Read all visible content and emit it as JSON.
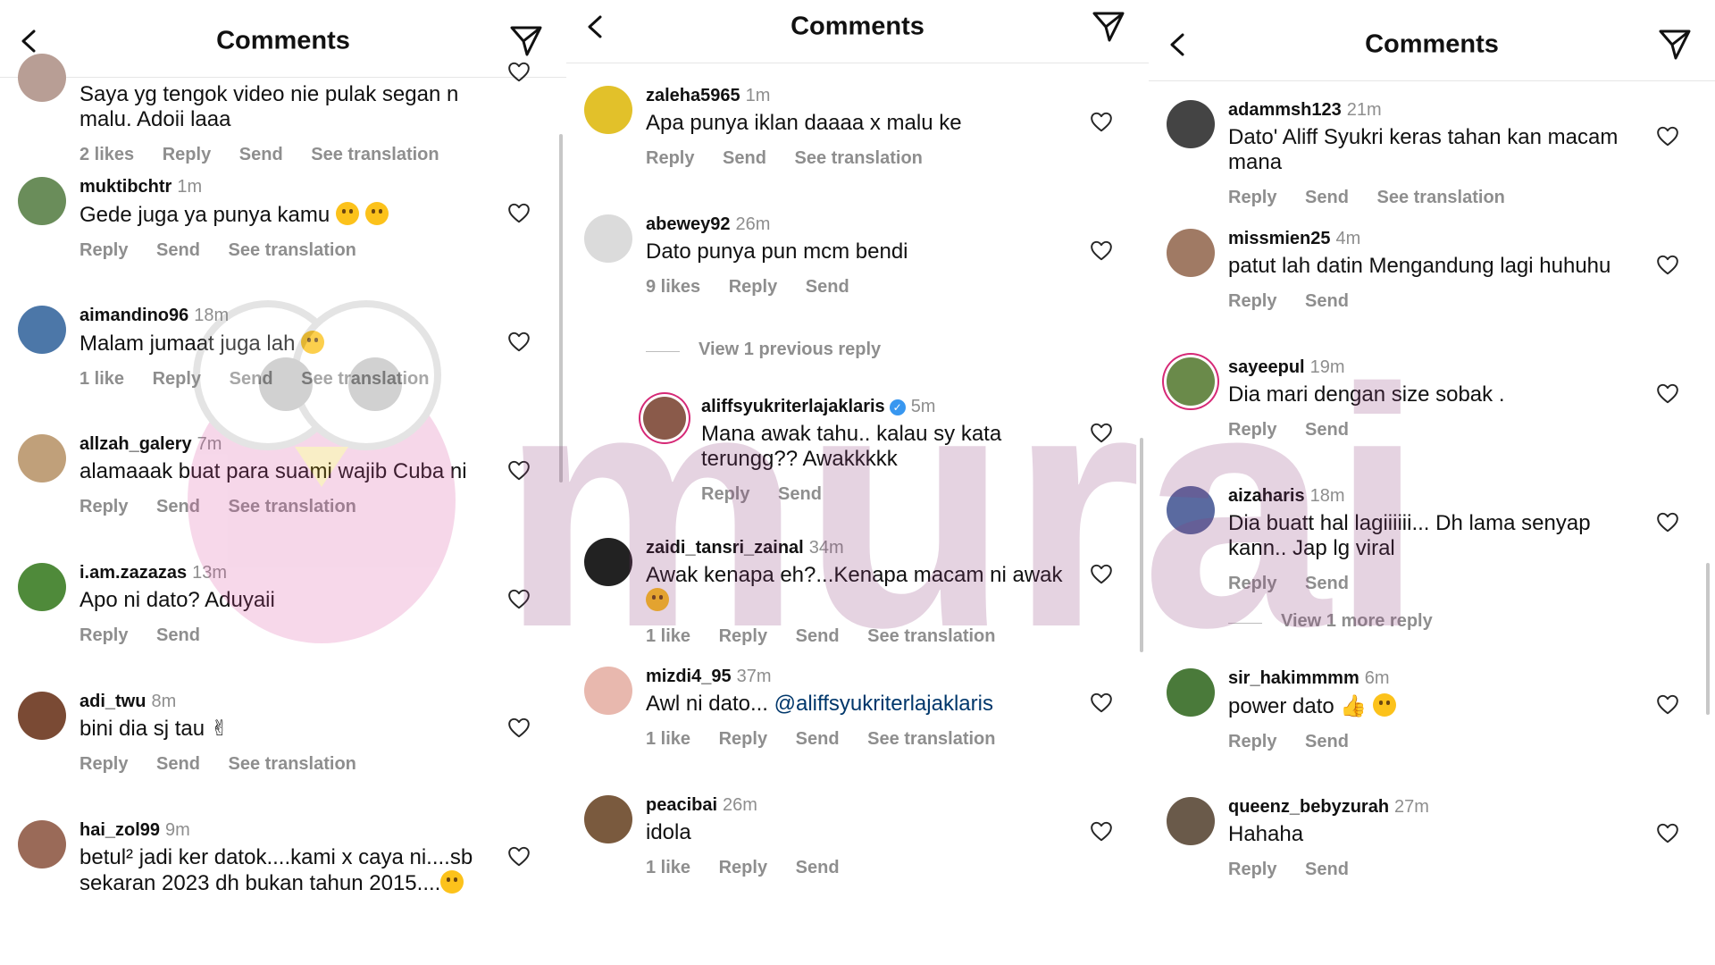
{
  "colors": {
    "text": "#111111",
    "meta": "#8e8e8e",
    "mention": "#00376b",
    "verified": "#3897f0",
    "accent": "#d62976"
  },
  "panels": [
    {
      "title": "Comments",
      "comments": [
        {
          "user": "",
          "time": "",
          "text": "Saya yg tengok video nie pulak segan n malu. Adoii laaa",
          "actions": [
            "2 likes",
            "Reply",
            "Send",
            "See translation"
          ],
          "avatar_color": "#b89e95"
        },
        {
          "user": "muktibchtr",
          "time": "1m",
          "text": "Gede juga ya punya kamu",
          "emoji": 2,
          "actions": [
            "Reply",
            "Send",
            "See translation"
          ],
          "avatar_color": "#6a8d5a"
        },
        {
          "user": "aimandino96",
          "time": "18m",
          "text": "Malam jumaat juga lah",
          "emoji": 1,
          "actions": [
            "1 like",
            "Reply",
            "Send",
            "See translation"
          ],
          "avatar_color": "#4c77a8"
        },
        {
          "user": "allzah_galery",
          "time": "7m",
          "text": "alamaaak  buat para suami wajib Cuba ni",
          "actions": [
            "Reply",
            "Send",
            "See translation"
          ],
          "avatar_color": "#c0a07a"
        },
        {
          "user": "i.am.zazazas",
          "time": "13m",
          "text": "Apo ni dato? Aduyaii",
          "actions": [
            "Reply",
            "Send"
          ],
          "avatar_color": "#4f8a3a"
        },
        {
          "user": "adi_twu",
          "time": "8m",
          "text": "bini dia sj tau",
          "actions": [
            "Reply",
            "Send",
            "See translation"
          ],
          "avatar_color": "#7a4a34"
        },
        {
          "user": "hai_zol99",
          "time": "9m",
          "text": "betul² jadi ker datok....kami x caya ni....sb sekaran 2023 dh bukan tahun 2015....",
          "actions": [],
          "avatar_color": "#9a6a58"
        }
      ]
    },
    {
      "title": "Comments",
      "comments": [
        {
          "user": "zaleha5965",
          "time": "1m",
          "text": "Apa punya iklan daaaa x malu ke",
          "actions": [
            "Reply",
            "Send",
            "See translation"
          ],
          "avatar_color": "#e2c12a"
        },
        {
          "user": "abewey92",
          "time": "26m",
          "text": "Dato punya pun mcm bendi",
          "actions": [
            "9 likes",
            "Reply",
            "Send"
          ],
          "avatar_color": "#dbdbdb"
        }
      ],
      "view_replies": "View 1 previous reply",
      "reply": {
        "user": "aliffsyukriterlajaklaris",
        "time": "5m",
        "text": "Mana awak tahu.. kalau sy kata terungg?? Awakkkkk",
        "actions": [
          "Reply",
          "Send"
        ],
        "avatar_color": "#8a5a4a"
      },
      "comments_after": [
        {
          "user": "zaidi_tansri_zainal",
          "time": "34m",
          "text": "Awak kenapa eh?...Kenapa macam ni awak",
          "actions": [
            "1 like",
            "Reply",
            "Send",
            "See translation"
          ],
          "avatar_color": "#222222"
        },
        {
          "user": "mizdi4_95",
          "time": "37m",
          "text": "Awl ni dato... ",
          "mention": "@aliffsyukriterlajaklaris",
          "actions": [
            "1 like",
            "Reply",
            "Send",
            "See translation"
          ],
          "avatar_color": "#e8b8ae"
        },
        {
          "user": "peacibai",
          "time": "26m",
          "text": "idola",
          "actions": [
            "1 like",
            "Reply",
            "Send"
          ],
          "avatar_color": "#7a5a3e"
        }
      ]
    },
    {
      "title": "Comments",
      "comments": [
        {
          "user": "adammsh123",
          "time": "21m",
          "text": "Dato' Aliff Syukri keras tahan kan macam mana",
          "actions": [
            "Reply",
            "Send",
            "See translation"
          ],
          "avatar_color": "#444444"
        },
        {
          "user": "missmien25",
          "time": "4m",
          "text": "patut lah datin Mengandung lagi huhuhu",
          "actions": [
            "Reply",
            "Send"
          ],
          "avatar_color": "#a07a64"
        },
        {
          "user": "sayeepul",
          "time": "19m",
          "text": "Dia mari dengan size sobak .",
          "actions": [
            "Reply",
            "Send"
          ],
          "avatar_color": "#6a8a4a",
          "ring": true
        },
        {
          "user": "aizaharis",
          "time": "18m",
          "text": "Dia buatt hal lagiiiiii... Dh lama senyap kann.. Jap lg viral",
          "actions": [
            "Reply",
            "Send"
          ],
          "avatar_color": "#5a6aa0"
        }
      ],
      "view_replies": "View 1 more reply",
      "comments_after": [
        {
          "user": "sir_hakimmmm",
          "time": "6m",
          "text": "power dato",
          "emoji": 1,
          "actions": [
            "Reply",
            "Send"
          ],
          "avatar_color": "#4a7a3a"
        },
        {
          "user": "queenz_bebyzurah",
          "time": "27m",
          "text": "Hahaha",
          "actions": [
            "Reply",
            "Send"
          ],
          "avatar_color": "#6a5a4a"
        }
      ]
    }
  ],
  "watermark": "murai"
}
